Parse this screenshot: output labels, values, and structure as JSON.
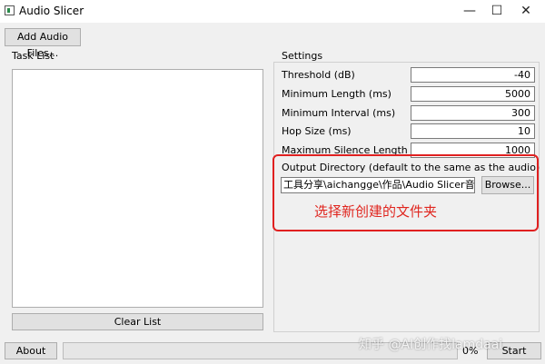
{
  "window": {
    "title": "Audio Slicer",
    "minimize": "—",
    "maximize": "☐",
    "close": "✕"
  },
  "toolbar": {
    "add_files_label": "Add Audio Files..."
  },
  "task_list": {
    "title": "Task List",
    "clear_label": "Clear List"
  },
  "settings": {
    "title": "Settings",
    "fields": [
      {
        "label": "Threshold (dB)",
        "value": "-40"
      },
      {
        "label": "Minimum Length (ms)",
        "value": "5000"
      },
      {
        "label": "Minimum Interval (ms)",
        "value": "300"
      },
      {
        "label": "Hop Size (ms)",
        "value": "10"
      },
      {
        "label": "Maximum Silence Length (ms)",
        "value": "1000"
      }
    ],
    "output_dir_label": "Output Directory (default to the same as the audio)",
    "output_dir_value": "工具分享\\aichangge\\作品\\Audio Slicer音频切分",
    "browse_label": "Browse..."
  },
  "annotation": {
    "text": "选择新创建的文件夹",
    "color": "#e0261f"
  },
  "footer": {
    "about_label": "About",
    "progress_text": "0%",
    "progress": 0,
    "start_label": "Start"
  },
  "watermark": {
    "text": "知乎 @AI创作找lamdaai"
  }
}
